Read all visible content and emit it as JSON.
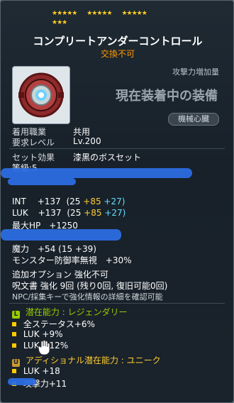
{
  "stars": {
    "row1": [
      "★★★★★",
      "★★★★★",
      "★★★★★"
    ],
    "row2": [
      "★★★"
    ]
  },
  "item": {
    "title": "コンプリートアンダーコントロール",
    "trade": "交換不可",
    "attack_increase_label": "攻撃力増加量",
    "equipped_label": "現在装着中の装備",
    "category_badge": "機械心臓"
  },
  "requirements": {
    "job_label": "着用職業",
    "job_value": "共用",
    "level_label": "要求レベル",
    "level_value": "Lv.200"
  },
  "set": {
    "label": "セット効果",
    "value": "漆黒のボスセット"
  },
  "stats": {
    "grade": "等級:5",
    "int_label": "INT",
    "int_total": "+137",
    "int_base": "(25",
    "int_star": "+85",
    "int_extra": "+27)",
    "luk_label": "LUK",
    "luk_total": "+137",
    "luk_base": "(25",
    "luk_star": "+85",
    "luk_extra": "+27)",
    "hp": "最大HP　+1250",
    "magic": "魔力　+54 (15 +39)",
    "ignore_def": "モンスター防御率無視　+30%"
  },
  "extra": {
    "additional_option": "追加オプション 強化不可",
    "scroll": "呪文書 強化 9回 (残り0回, 復旧可能0回)",
    "npc_hint": "NPC/採集キーで強化情報の詳細を確認可能"
  },
  "potential": {
    "header_icon": "L",
    "header": "潜在能力 : レジェンダリー",
    "lines": [
      "全ステータス+6%",
      "LUK +9%",
      "LUK +12%"
    ]
  },
  "additional_potential": {
    "header_icon": "U",
    "header": "アディショナル潜在能力 : ユニーク",
    "lines": [
      "LUK +18",
      "攻撃力+11"
    ]
  },
  "colors": {
    "accent_yellow": "#ffcc33",
    "accent_orange": "#ff9900",
    "legendary": "#99cc00",
    "unique": "#cc9933"
  }
}
